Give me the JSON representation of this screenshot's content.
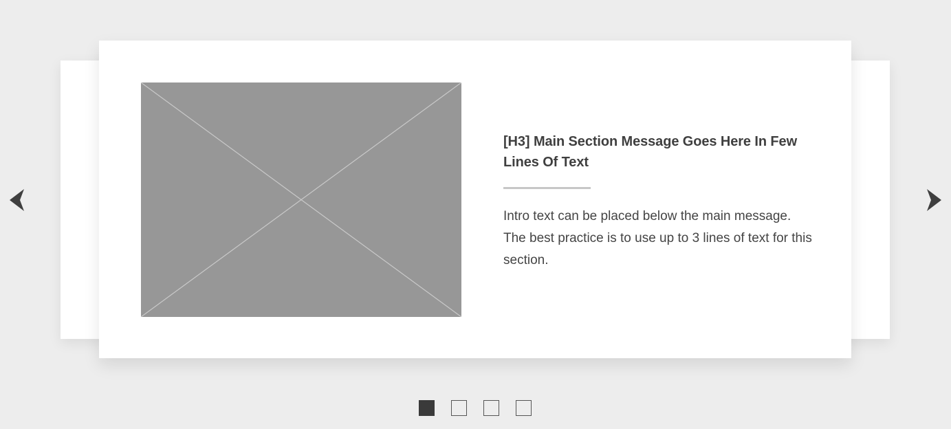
{
  "carousel": {
    "slide": {
      "image": {
        "placeholder_icon": "image-placeholder-x-icon"
      },
      "heading": "[H3] Main Section Message Goes Here In Few Lines Of Text",
      "intro": "Intro text can be placed below the main message. The best practice is to use up to 3 lines of text for this section."
    },
    "navigation": {
      "prev_icon": "chevron-left-icon",
      "next_icon": "chevron-right-icon"
    },
    "indicators": {
      "count": 4,
      "active_index": 0
    }
  },
  "colors": {
    "background": "#ededed",
    "card": "#ffffff",
    "placeholder": "#979797",
    "text": "#444444",
    "accent": "#3a3a3a",
    "divider": "#c7c7c7"
  }
}
